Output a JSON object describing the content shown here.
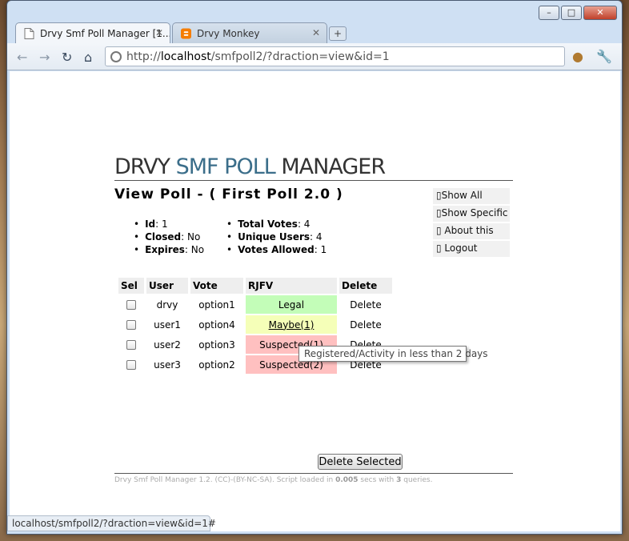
{
  "window": {
    "minimize_glyph": "–",
    "maximize_glyph": "□",
    "close_glyph": "✕"
  },
  "tabs": [
    {
      "label": "Drvy Smf Poll Manager [1...",
      "active": true,
      "icon": "page-icon"
    },
    {
      "label": "Drvy Monkey",
      "active": false,
      "icon": "blogger-icon"
    }
  ],
  "toolbar": {
    "url_host": "localhost",
    "url_path": "/smfpoll2/?draction=view&id=1",
    "url_scheme": "http://"
  },
  "page": {
    "logo_part1": "DRVY ",
    "logo_part2": "SMF POLL",
    "logo_part3": " MANAGER",
    "title": "View Poll - ( First Poll 2.0 )",
    "menu": [
      "▯Show All",
      "▯Show Specific",
      "▯ About this",
      "▯ Logout"
    ],
    "info_left": [
      {
        "label": "Id",
        "value": " 1"
      },
      {
        "label": "Closed",
        "value": " No"
      },
      {
        "label": "Expires",
        "value": " No"
      }
    ],
    "info_right": [
      {
        "label": "Total Votes",
        "value": " 4"
      },
      {
        "label": "Unique Users",
        "value": " 4"
      },
      {
        "label": "Votes Allowed",
        "value": " 1"
      }
    ],
    "table_headers": [
      "Sel",
      "User",
      "Vote",
      "RJFV",
      "Delete"
    ],
    "rows": [
      {
        "user": "drvy",
        "vote": "option1",
        "rjfv": "Legal",
        "status": "legal",
        "delete": "Delete"
      },
      {
        "user": "user1",
        "vote": "option4",
        "rjfv": "Maybe(1)",
        "status": "maybe",
        "delete": "Delete"
      },
      {
        "user": "user2",
        "vote": "option3",
        "rjfv": "Suspected(1)",
        "status": "susp",
        "delete": "Delete"
      },
      {
        "user": "user3",
        "vote": "option2",
        "rjfv": "Suspected(2)",
        "status": "susp",
        "delete": "Delete"
      }
    ],
    "delete_selected": "Delete Selected",
    "footer_text": "Drvy Smf Poll Manager 1.2. (CC)-(BY-NC-SA). Script loaded in ",
    "footer_time": "0.005",
    "footer_mid": " secs with ",
    "footer_queries": "3",
    "footer_end": " queries."
  },
  "tooltip": "Registered/Activity in less than 2 days",
  "status_bar": "localhost/smfpoll2/?draction=view&id=1#",
  "colors": {
    "legal": "#c3fdb8",
    "maybe": "#f5ffb8",
    "suspected": "#ffc0c0",
    "logo_accent": "#3b6e8a"
  }
}
